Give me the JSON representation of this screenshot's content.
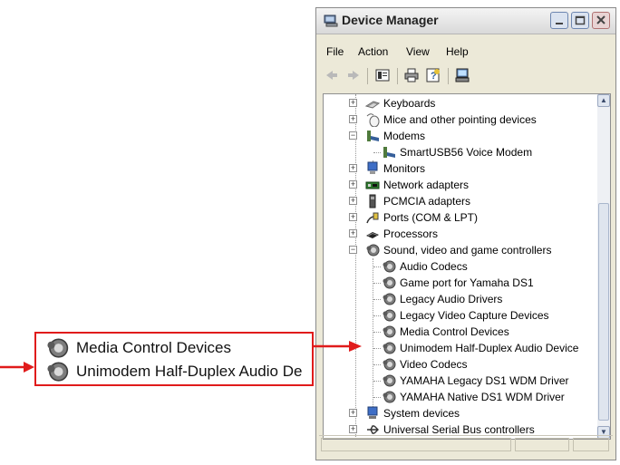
{
  "window": {
    "title": "Device Manager",
    "buttons": [
      "minimize",
      "maximize",
      "close"
    ]
  },
  "menu": [
    "File",
    "Action",
    "View",
    "Help"
  ],
  "toolbar": [
    "back-icon",
    "forward-icon",
    "properties-icon",
    "print-icon",
    "help-icon",
    "computer-icon"
  ],
  "tree": [
    {
      "label": "Keyboards",
      "level": 0,
      "expander": "+",
      "icon": "keyboard-icon"
    },
    {
      "label": "Mice and other pointing devices",
      "level": 0,
      "expander": "+",
      "icon": "mouse-icon"
    },
    {
      "label": "Modems",
      "level": 0,
      "expander": "-",
      "icon": "modem-icon"
    },
    {
      "label": "SmartUSB56 Voice Modem",
      "level": 1,
      "icon": "modem-icon"
    },
    {
      "label": "Monitors",
      "level": 0,
      "expander": "+",
      "icon": "monitor-icon"
    },
    {
      "label": "Network adapters",
      "level": 0,
      "expander": "+",
      "icon": "network-adapter-icon"
    },
    {
      "label": "PCMCIA adapters",
      "level": 0,
      "expander": "+",
      "icon": "pcmcia-icon"
    },
    {
      "label": "Ports (COM & LPT)",
      "level": 0,
      "expander": "+",
      "icon": "port-icon"
    },
    {
      "label": "Processors",
      "level": 0,
      "expander": "+",
      "icon": "processor-icon"
    },
    {
      "label": "Sound, video and game controllers",
      "level": 0,
      "expander": "-",
      "icon": "speaker-icon"
    },
    {
      "label": "Audio Codecs",
      "level": 1,
      "icon": "speaker-icon"
    },
    {
      "label": "Game port for Yamaha DS1",
      "level": 1,
      "icon": "speaker-icon"
    },
    {
      "label": "Legacy Audio Drivers",
      "level": 1,
      "icon": "speaker-icon"
    },
    {
      "label": "Legacy Video Capture Devices",
      "level": 1,
      "icon": "speaker-icon"
    },
    {
      "label": "Media Control Devices",
      "level": 1,
      "icon": "speaker-icon"
    },
    {
      "label": "Unimodem Half-Duplex Audio Device",
      "level": 1,
      "icon": "speaker-icon"
    },
    {
      "label": "Video Codecs",
      "level": 1,
      "icon": "speaker-icon"
    },
    {
      "label": "YAMAHA Legacy DS1 WDM Driver",
      "level": 1,
      "icon": "speaker-icon"
    },
    {
      "label": "YAMAHA Native DS1 WDM Driver",
      "level": 1,
      "icon": "speaker-icon"
    },
    {
      "label": "System devices",
      "level": 0,
      "expander": "+",
      "icon": "system-icon"
    },
    {
      "label": "Universal Serial Bus controllers",
      "level": 0,
      "expander": "+",
      "icon": "usb-icon"
    }
  ],
  "callout": {
    "items": [
      {
        "label": "Media Control Devices",
        "icon": "speaker-icon"
      },
      {
        "label": "Unimodem Half-Duplex Audio De",
        "icon": "speaker-icon"
      }
    ],
    "color": "#e01b1b"
  },
  "colors": {
    "accent": "#e01b1b",
    "window_bg": "#ece9d8"
  }
}
